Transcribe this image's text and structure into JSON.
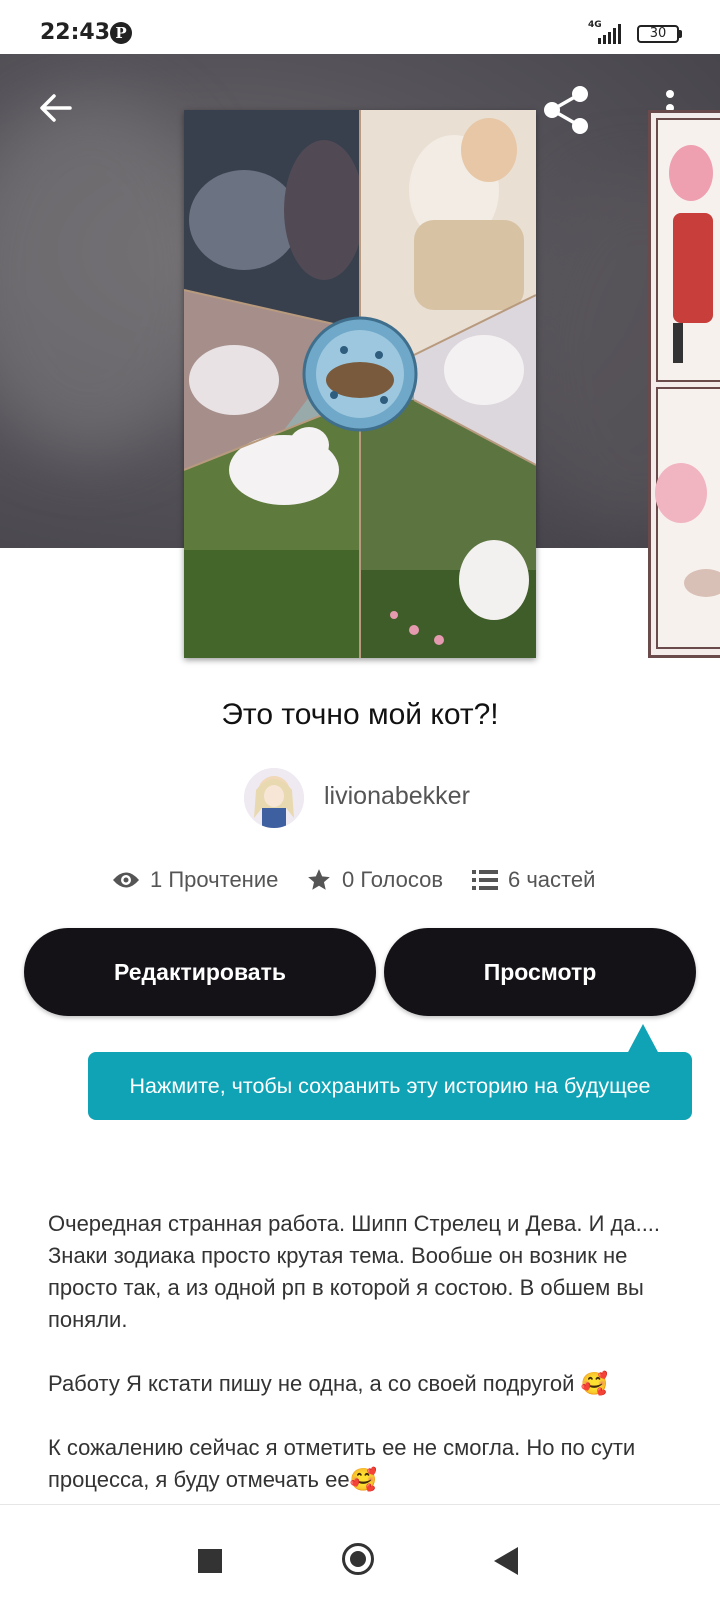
{
  "status_bar": {
    "time": "22:43",
    "notification_icon": "pinterest-icon",
    "network": "4G",
    "battery": "30"
  },
  "header": {
    "back_icon": "back-arrow-icon",
    "share_icon": "share-icon",
    "more_icon": "more-vert-icon"
  },
  "story": {
    "title": "Это точно мой кот?!",
    "author": "livionabekker",
    "stats": {
      "reads": "1 Прочтение",
      "votes": "0 Голосов",
      "parts": "6 частей"
    }
  },
  "actions": {
    "edit_label": "Редактировать",
    "view_label": "Просмотр"
  },
  "tooltip": {
    "text": "Нажмите, чтобы сохранить эту историю на будущее"
  },
  "description": {
    "paragraphs": [
      "Очередная странная работа. Шипп Стрелец и Дева. И да.... Знаки зодиака просто крутая тема. Вообше он возник не просто так, а из одной рп в которой я состою. В обшем вы поняли.",
      "Работу Я кстати пишу не одна, а со своей подругой 🥰",
      "К сожалению сейчас я отметить ее не смогла. Но по сути процесса, я буду отмечать ее🥰"
    ]
  },
  "nav_bar": {
    "recent_icon": "recent-apps-icon",
    "home_icon": "home-icon",
    "back_icon": "nav-back-icon"
  },
  "colors": {
    "button_bg": "#141217",
    "tooltip_bg": "#0fa3b5",
    "hero_bg": "#56535a"
  }
}
